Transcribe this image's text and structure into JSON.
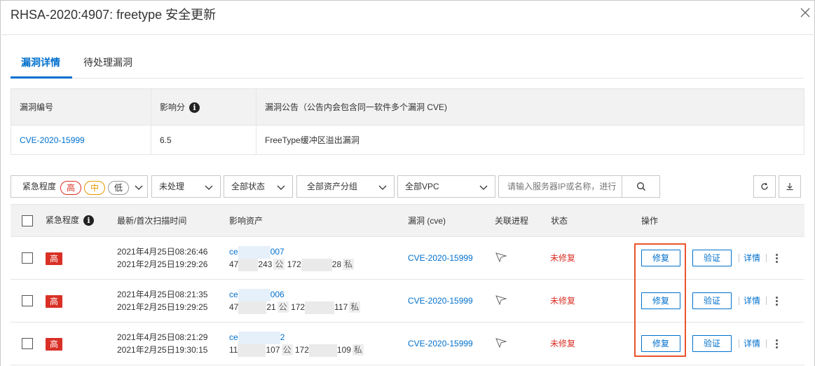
{
  "dialog": {
    "title": "RHSA-2020:4907: freetype 安全更新"
  },
  "tabs": [
    {
      "label": "漏洞详情",
      "active": true
    },
    {
      "label": "待处理漏洞",
      "active": false
    }
  ],
  "info_table": {
    "headers": [
      "漏洞编号",
      "影响分",
      "漏洞公告（公告内会包含同一软件多个漏洞 CVE)"
    ],
    "row": {
      "cve": "CVE-2020-15999",
      "score": "6.5",
      "notice": "FreeType缓冲区溢出漏洞"
    }
  },
  "filters": {
    "urgency_label": "紧急程度",
    "urgency_options": [
      "高",
      "中",
      "低"
    ],
    "handling_status": "未处理",
    "all_status": "全部状态",
    "asset_group": "全部资产分组",
    "vpc": "全部VPC",
    "search_placeholder": "请输入服务器IP或名称，进行"
  },
  "grid": {
    "headers": {
      "urgency": "紧急程度",
      "scan_time": "最新/首次扫描时间",
      "asset": "影响资产",
      "vuln": "漏洞 (cve)",
      "process": "关联进程",
      "status": "状态",
      "action": "操作"
    },
    "rows": [
      {
        "urgency": "高",
        "latest": "2021年4月25日08:26:46",
        "first": "2021年2月25日19:29:26",
        "asset_name_pre": "ce",
        "asset_name_post": "007",
        "ip_pub_pre": "47",
        "ip_pub_post": "243",
        "pub_tag": "公",
        "ip_priv_pre": "172",
        "ip_priv_post": "28",
        "priv_tag": "私",
        "cve": "CVE-2020-15999",
        "status": "未修复",
        "fix": "修复",
        "verify": "验证",
        "detail": "详情"
      },
      {
        "urgency": "高",
        "latest": "2021年4月25日08:21:35",
        "first": "2021年2月25日19:29:25",
        "asset_name_pre": "ce",
        "asset_name_post": "006",
        "ip_pub_pre": "47",
        "ip_pub_post": "21",
        "pub_tag": "公",
        "ip_priv_pre": "172",
        "ip_priv_post": "117",
        "priv_tag": "私",
        "cve": "CVE-2020-15999",
        "status": "未修复",
        "fix": "修复",
        "verify": "验证",
        "detail": "详情"
      },
      {
        "urgency": "高",
        "latest": "2021年4月25日08:21:29",
        "first": "2021年2月25日19:30:15",
        "asset_name_pre": "ce",
        "asset_name_post": "2",
        "ip_pub_pre": "11",
        "ip_pub_post": "107",
        "pub_tag": "公",
        "ip_priv_pre": "172",
        "ip_priv_post": "109",
        "priv_tag": "私",
        "cve": "CVE-2020-15999",
        "status": "未修复",
        "fix": "修复",
        "verify": "验证",
        "detail": "详情"
      }
    ]
  },
  "colors": {
    "accent": "#0070cc",
    "danger": "#d93026",
    "highlight": "#e8542d"
  }
}
